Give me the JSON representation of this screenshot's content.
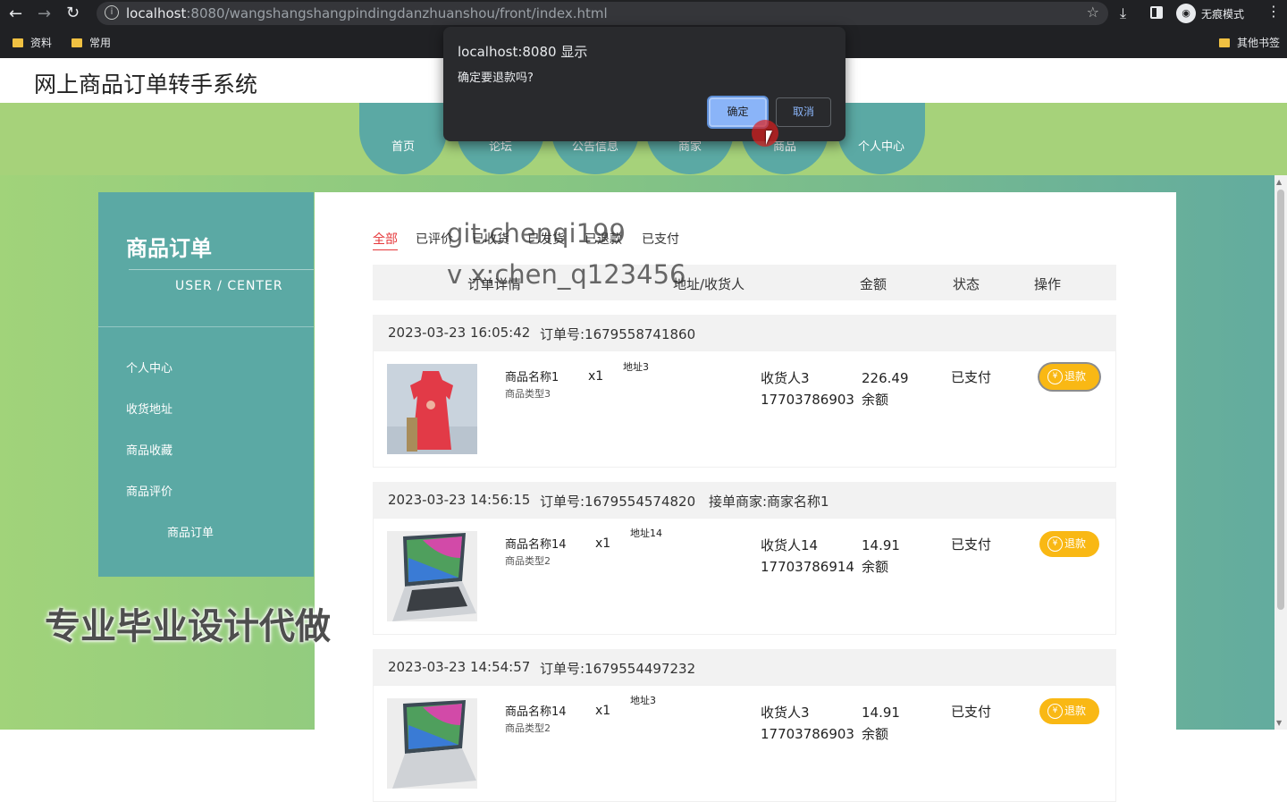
{
  "browser": {
    "url_host": "localhost",
    "url_rest": ":8080/wangshangshangpindingdanzhuanshou/front/index.html",
    "incognito_label": "无痕模式",
    "bookmarks": [
      "资料",
      "常用"
    ],
    "other_bookmarks": "其他书签"
  },
  "site": {
    "title": "网上商品订单转手系统",
    "nav": [
      "首页",
      "论坛",
      "公告信息",
      "商家",
      "商品",
      "个人中心"
    ],
    "colors": {
      "banner": "#a6d27a",
      "nav": "#5ba9a4",
      "accent": "#e5383b",
      "refund": "#f9b814"
    }
  },
  "sidebar": {
    "title": "商品订单",
    "subtitle": "USER / CENTER",
    "items": [
      "个人中心",
      "收货地址",
      "商品收藏",
      "商品评价",
      "商品订单"
    ]
  },
  "tabs": [
    "全部",
    "已评价",
    "已收货",
    "已发货",
    "已退款",
    "已支付"
  ],
  "table_headers": [
    "订单详情",
    "地址/收货人",
    "金额",
    "状态",
    "操作"
  ],
  "orders": [
    {
      "time": "2023-03-23 16:05:42",
      "order_no": "订单号:1679558741860",
      "merchant": "",
      "product_name": "商品名称1",
      "product_type": "商品类型3",
      "qty": "x1",
      "address": "地址3",
      "receiver": "收货人3",
      "phone": "17703786903",
      "amount": "226.49",
      "pay_method": "余额",
      "status": "已支付",
      "action": "退款",
      "thumb": "red-dress-icon"
    },
    {
      "time": "2023-03-23 14:56:15",
      "order_no": "订单号:1679554574820",
      "merchant": "接单商家:商家名称1",
      "product_name": "商品名称14",
      "product_type": "商品类型2",
      "qty": "x1",
      "address": "地址14",
      "receiver": "收货人14",
      "phone": "17703786914",
      "amount": "14.91",
      "pay_method": "余额",
      "status": "已支付",
      "action": "退款",
      "thumb": "laptop-icon"
    },
    {
      "time": "2023-03-23 14:54:57",
      "order_no": "订单号:1679554497232",
      "merchant": "",
      "product_name": "商品名称14",
      "product_type": "商品类型2",
      "qty": "x1",
      "address": "地址3",
      "receiver": "收货人3",
      "phone": "17703786903",
      "amount": "14.91",
      "pay_method": "余额",
      "status": "已支付",
      "action": "退款",
      "thumb": "laptop-icon"
    }
  ],
  "dialog": {
    "title": "localhost:8080 显示",
    "message": "确定要退款吗?",
    "ok": "确定",
    "cancel": "取消"
  },
  "watermarks": [
    "git:chenqi199",
    "v x:chen_q123456",
    "专业毕业设计代做"
  ]
}
